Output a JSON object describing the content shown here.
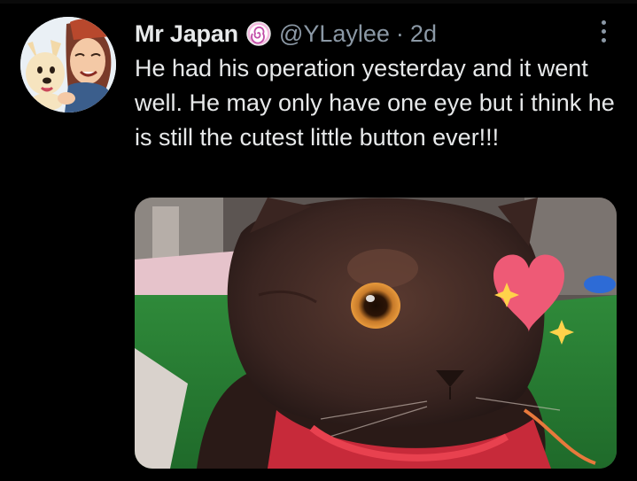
{
  "tweet": {
    "author": {
      "display_name": "Mr Japan",
      "badge_icon": "spiral-badge-icon",
      "handle": "@YLaylee",
      "separator": "·",
      "time": "2d",
      "avatar": "cartoon-person-with-dog-avatar"
    },
    "more_icon": "vertical-ellipsis-icon",
    "text": "He had his operation yesterday and it went well. He may only have one eye but i think he is still the cutest little button ever!!!",
    "media": {
      "kind": "photo",
      "subject": "dark brown one-eyed cat with red collar",
      "overlay_sticker": "heart-with-sparkles",
      "heart_color": "#ee5a76",
      "sparkle_color": "#ffd24a"
    }
  },
  "colors": {
    "background": "#000000",
    "primary_text": "#e7e9ea",
    "secondary_text": "#8b98a5",
    "badge_pink": "#f279c6",
    "badge_purple": "#9b6cf0"
  }
}
